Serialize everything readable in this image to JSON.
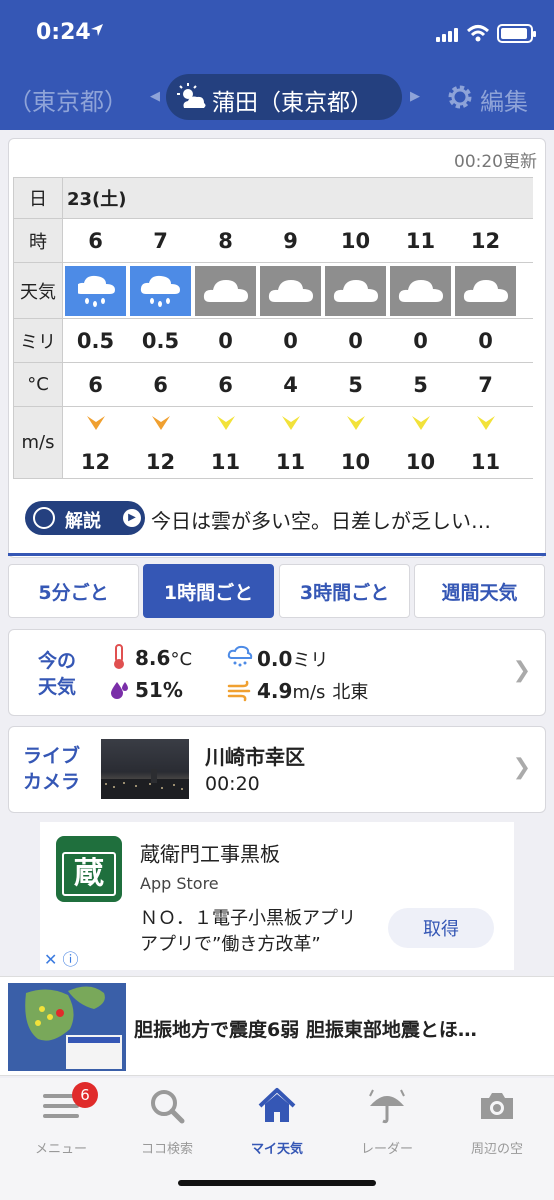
{
  "status_bar": {
    "time": "0:24"
  },
  "header": {
    "prev_location": "（東京都）",
    "current_location": "蒲田（東京都）",
    "edit_label": "編集"
  },
  "forecast": {
    "updated": "00:20更新",
    "row_labels": {
      "day": "日",
      "hour": "時",
      "weather": "天気",
      "precip": "ミリ",
      "temp": "°C",
      "wind": "m/s"
    },
    "day": "23(土)",
    "hours": [
      "6",
      "7",
      "8",
      "9",
      "10",
      "11",
      "12"
    ],
    "weather": [
      "rain-icon",
      "rain-icon",
      "cloud-icon",
      "cloud-icon",
      "cloud-icon",
      "cloud-icon",
      "cloud-icon"
    ],
    "precip": [
      "0.5",
      "0.5",
      "0",
      "0",
      "0",
      "0",
      "0"
    ],
    "temps": [
      "6",
      "6",
      "6",
      "4",
      "5",
      "5",
      "7"
    ],
    "wind_speed": [
      "12",
      "12",
      "11",
      "11",
      "10",
      "10",
      "11"
    ],
    "wind_color": [
      "#f0a030",
      "#f0a030",
      "#f2e23a",
      "#f2e23a",
      "#f2e23a",
      "#f2e23a",
      "#f2e23a"
    ],
    "explain_label": "解説",
    "explain_text": "今日は雲が多い空。日差しが乏しい…"
  },
  "tabs": [
    "5分ごと",
    "1時間ごと",
    "3時間ごと",
    "週間天気"
  ],
  "now": {
    "label_line1": "今の",
    "label_line2": "天気",
    "temp_value": "8.6",
    "temp_unit": "°C",
    "humidity": "51%",
    "precip_value": "0.0",
    "precip_unit": "ミリ",
    "wind_value": "4.9",
    "wind_unit": "m/s",
    "wind_dir": "北東"
  },
  "live_camera": {
    "label_line1": "ライブ",
    "label_line2": "カメラ",
    "place": "川崎市幸区",
    "time": "00:20"
  },
  "ad": {
    "title": "蔵衛門工事黒板",
    "store": "App Store",
    "desc1": "ＮＯ．１電子小黒板アプリ",
    "desc2": "アプリで”働き方改革”",
    "button": "取得",
    "logo_char": "蔵"
  },
  "news": {
    "headline": "胆振地方で震度6弱 胆振東部地震とほ…"
  },
  "tabbar": {
    "badge": "6",
    "items": [
      "メニュー",
      "ココ検索",
      "マイ天気",
      "レーダー",
      "周辺の空"
    ]
  },
  "colors": {
    "brand": "#3557b5",
    "brand_dark": "#24407f",
    "rain_cell": "#4d8be6",
    "cloud_cell": "#8e8e8e"
  }
}
